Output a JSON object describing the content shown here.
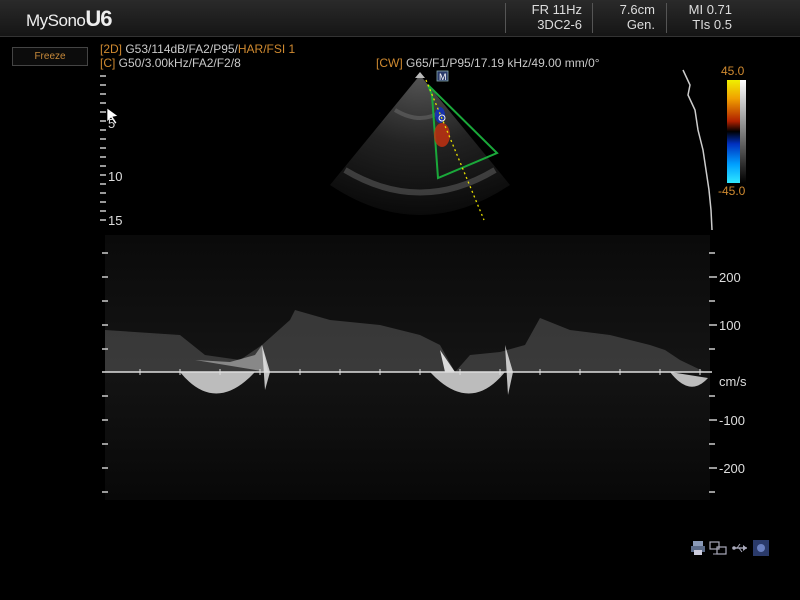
{
  "header": {
    "logo_text": "MySono",
    "logo_model": "U6",
    "frame_rate": "FR 11Hz",
    "probe": "3DC2-6",
    "depth": "7.6cm",
    "mode": "Gen.",
    "mi": "MI 0.71",
    "tis": "TIs 0.5"
  },
  "freeze_button": "Freeze",
  "params": {
    "line_2d_tag": "[2D]",
    "line_2d": " G53/114dB/FA2/P95/",
    "line_2d_har": "HAR/FSI 1",
    "line_c_tag": "[C]",
    "line_c": " G50/3.00kHz/FA2/F2/8",
    "line_cw_tag": "[CW]",
    "line_cw": " G65/F1/P95/17.19 kHz/49.00 mm/0°"
  },
  "depth_scale": [
    "5",
    "10",
    "15"
  ],
  "color_scale": {
    "max": "45.0",
    "min": "-45.0"
  },
  "velocity_scale": {
    "labels": [
      "200",
      "100",
      "-100",
      "-200"
    ],
    "unit": "cm/s"
  },
  "colors": {
    "accent_orange": "#d08a30",
    "sector_outline": "#1aa83a",
    "cursor_line": "#e8e000"
  },
  "icons": [
    "printer-icon",
    "network-icon",
    "usb-icon",
    "display-icon"
  ]
}
